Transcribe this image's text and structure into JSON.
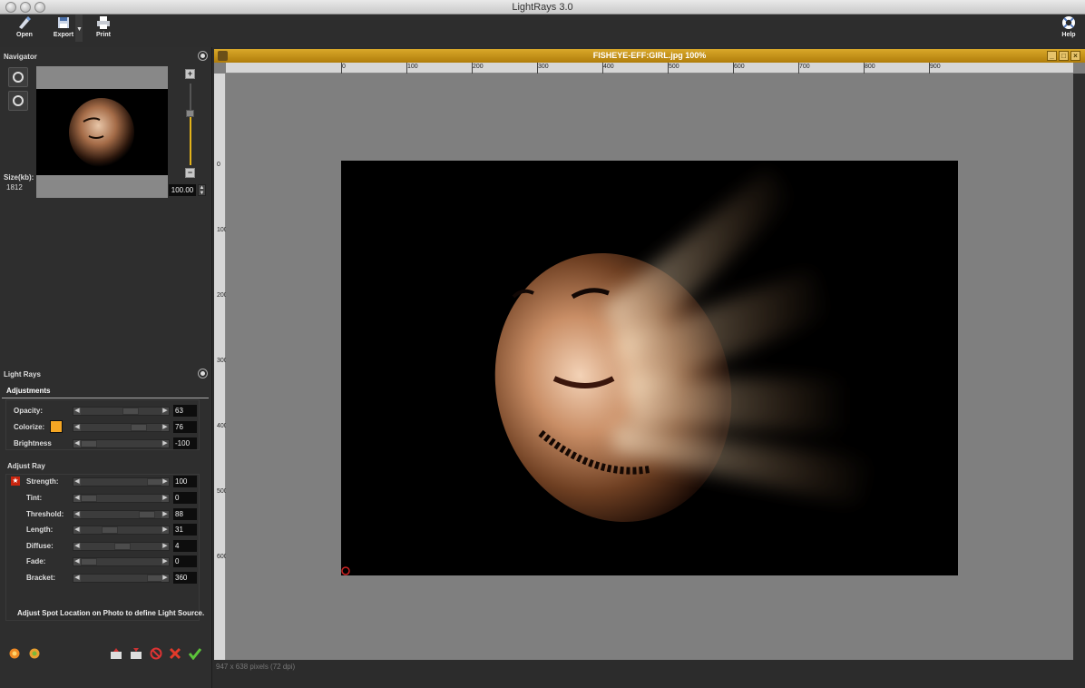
{
  "window": {
    "title": "LightRays 3.0"
  },
  "toolbar": {
    "open_label": "Open",
    "export_label": "Export",
    "print_label": "Print",
    "help_label": "Help"
  },
  "navigator": {
    "title": "Navigator",
    "size_label": "Size(kb):",
    "size_value": "1812",
    "zoom_value": "100.00"
  },
  "lightrays": {
    "title": "Light Rays",
    "tab_label": "Adjustments",
    "adjustments": [
      {
        "label": "Opacity:",
        "value": "63",
        "level": 0.63
      },
      {
        "label": "Colorize:",
        "value": "76",
        "level": 0.76
      },
      {
        "label": "Brightness",
        "value": "-100",
        "level": 0.0
      }
    ],
    "adjust_ray_title": "Adjust Ray",
    "rays": [
      {
        "label": "Strength:",
        "value": "100",
        "level": 1.0
      },
      {
        "label": "Tint:",
        "value": "0",
        "level": 0.0
      },
      {
        "label": "Threshold:",
        "value": "88",
        "level": 0.88
      },
      {
        "label": "Length:",
        "value": "31",
        "level": 0.31
      },
      {
        "label": "Diffuse:",
        "value": "4",
        "level": 0.5
      },
      {
        "label": "Fade:",
        "value": "0",
        "level": 0.0
      },
      {
        "label": "Bracket:",
        "value": "360",
        "level": 1.0
      }
    ],
    "hint": "Adjust Spot Location on Photo to define Light Source."
  },
  "document": {
    "title": "FISHEYE-EFF:GIRL.jpg 100%",
    "status": "947 x 638 pixels (72 dpi)",
    "hruler_labels": [
      "0",
      "100",
      "200",
      "300",
      "400",
      "500",
      "600",
      "700",
      "800",
      "900"
    ],
    "vruler_labels": [
      "0",
      "100",
      "200",
      "300",
      "400",
      "500",
      "600"
    ]
  },
  "colors": {
    "accent": "#c9960f",
    "colorize_swatch": "#f5a623",
    "photo_bg": "#000000"
  }
}
